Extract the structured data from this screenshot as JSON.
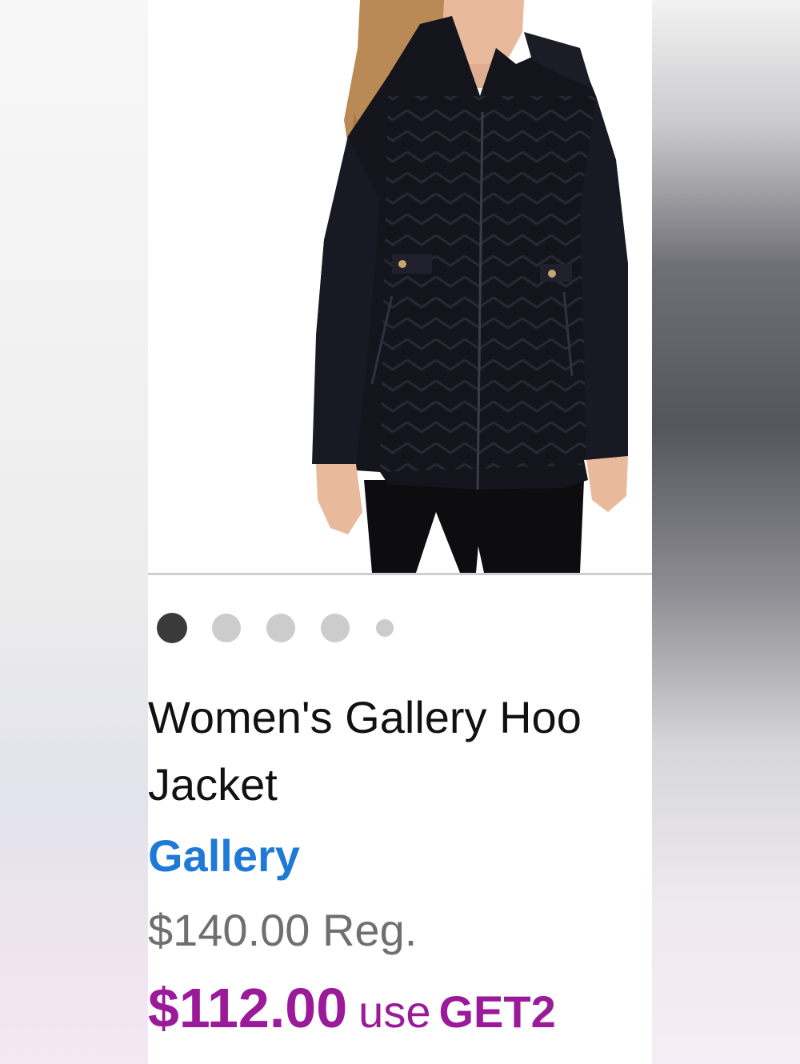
{
  "carousel": {
    "dot_count": 5,
    "active_index": 0
  },
  "product": {
    "title_line1": "Women's Gallery Hoo",
    "title_line2": "Jacket",
    "brand": "Gallery",
    "regular_price": "$140.00 Reg.",
    "sale_price": "$112.00",
    "promo_prefix": "use",
    "promo_code": "GET2"
  },
  "colors": {
    "brand_link": "#1f7ad6",
    "sale": "#9a1a9a",
    "jacket": "#14151c"
  }
}
